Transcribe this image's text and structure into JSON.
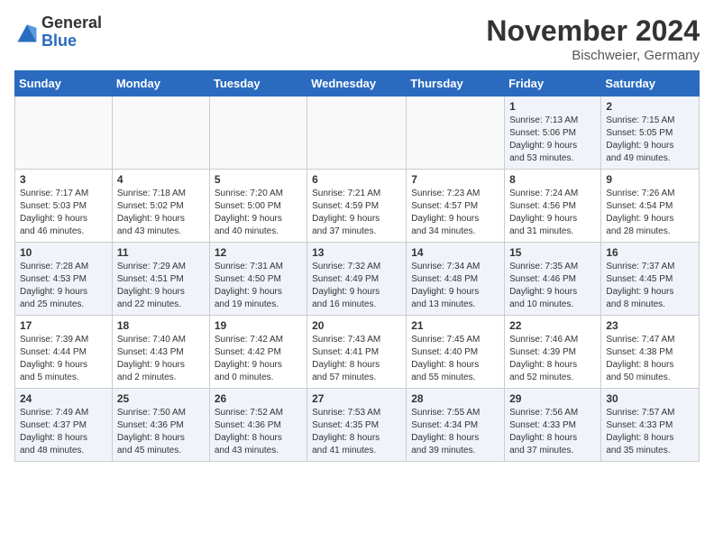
{
  "header": {
    "logo_general": "General",
    "logo_blue": "Blue",
    "month_title": "November 2024",
    "location": "Bischweier, Germany"
  },
  "weekdays": [
    "Sunday",
    "Monday",
    "Tuesday",
    "Wednesday",
    "Thursday",
    "Friday",
    "Saturday"
  ],
  "weeks": [
    [
      {
        "day": "",
        "info": ""
      },
      {
        "day": "",
        "info": ""
      },
      {
        "day": "",
        "info": ""
      },
      {
        "day": "",
        "info": ""
      },
      {
        "day": "",
        "info": ""
      },
      {
        "day": "1",
        "info": "Sunrise: 7:13 AM\nSunset: 5:06 PM\nDaylight: 9 hours\nand 53 minutes."
      },
      {
        "day": "2",
        "info": "Sunrise: 7:15 AM\nSunset: 5:05 PM\nDaylight: 9 hours\nand 49 minutes."
      }
    ],
    [
      {
        "day": "3",
        "info": "Sunrise: 7:17 AM\nSunset: 5:03 PM\nDaylight: 9 hours\nand 46 minutes."
      },
      {
        "day": "4",
        "info": "Sunrise: 7:18 AM\nSunset: 5:02 PM\nDaylight: 9 hours\nand 43 minutes."
      },
      {
        "day": "5",
        "info": "Sunrise: 7:20 AM\nSunset: 5:00 PM\nDaylight: 9 hours\nand 40 minutes."
      },
      {
        "day": "6",
        "info": "Sunrise: 7:21 AM\nSunset: 4:59 PM\nDaylight: 9 hours\nand 37 minutes."
      },
      {
        "day": "7",
        "info": "Sunrise: 7:23 AM\nSunset: 4:57 PM\nDaylight: 9 hours\nand 34 minutes."
      },
      {
        "day": "8",
        "info": "Sunrise: 7:24 AM\nSunset: 4:56 PM\nDaylight: 9 hours\nand 31 minutes."
      },
      {
        "day": "9",
        "info": "Sunrise: 7:26 AM\nSunset: 4:54 PM\nDaylight: 9 hours\nand 28 minutes."
      }
    ],
    [
      {
        "day": "10",
        "info": "Sunrise: 7:28 AM\nSunset: 4:53 PM\nDaylight: 9 hours\nand 25 minutes."
      },
      {
        "day": "11",
        "info": "Sunrise: 7:29 AM\nSunset: 4:51 PM\nDaylight: 9 hours\nand 22 minutes."
      },
      {
        "day": "12",
        "info": "Sunrise: 7:31 AM\nSunset: 4:50 PM\nDaylight: 9 hours\nand 19 minutes."
      },
      {
        "day": "13",
        "info": "Sunrise: 7:32 AM\nSunset: 4:49 PM\nDaylight: 9 hours\nand 16 minutes."
      },
      {
        "day": "14",
        "info": "Sunrise: 7:34 AM\nSunset: 4:48 PM\nDaylight: 9 hours\nand 13 minutes."
      },
      {
        "day": "15",
        "info": "Sunrise: 7:35 AM\nSunset: 4:46 PM\nDaylight: 9 hours\nand 10 minutes."
      },
      {
        "day": "16",
        "info": "Sunrise: 7:37 AM\nSunset: 4:45 PM\nDaylight: 9 hours\nand 8 minutes."
      }
    ],
    [
      {
        "day": "17",
        "info": "Sunrise: 7:39 AM\nSunset: 4:44 PM\nDaylight: 9 hours\nand 5 minutes."
      },
      {
        "day": "18",
        "info": "Sunrise: 7:40 AM\nSunset: 4:43 PM\nDaylight: 9 hours\nand 2 minutes."
      },
      {
        "day": "19",
        "info": "Sunrise: 7:42 AM\nSunset: 4:42 PM\nDaylight: 9 hours\nand 0 minutes."
      },
      {
        "day": "20",
        "info": "Sunrise: 7:43 AM\nSunset: 4:41 PM\nDaylight: 8 hours\nand 57 minutes."
      },
      {
        "day": "21",
        "info": "Sunrise: 7:45 AM\nSunset: 4:40 PM\nDaylight: 8 hours\nand 55 minutes."
      },
      {
        "day": "22",
        "info": "Sunrise: 7:46 AM\nSunset: 4:39 PM\nDaylight: 8 hours\nand 52 minutes."
      },
      {
        "day": "23",
        "info": "Sunrise: 7:47 AM\nSunset: 4:38 PM\nDaylight: 8 hours\nand 50 minutes."
      }
    ],
    [
      {
        "day": "24",
        "info": "Sunrise: 7:49 AM\nSunset: 4:37 PM\nDaylight: 8 hours\nand 48 minutes."
      },
      {
        "day": "25",
        "info": "Sunrise: 7:50 AM\nSunset: 4:36 PM\nDaylight: 8 hours\nand 45 minutes."
      },
      {
        "day": "26",
        "info": "Sunrise: 7:52 AM\nSunset: 4:36 PM\nDaylight: 8 hours\nand 43 minutes."
      },
      {
        "day": "27",
        "info": "Sunrise: 7:53 AM\nSunset: 4:35 PM\nDaylight: 8 hours\nand 41 minutes."
      },
      {
        "day": "28",
        "info": "Sunrise: 7:55 AM\nSunset: 4:34 PM\nDaylight: 8 hours\nand 39 minutes."
      },
      {
        "day": "29",
        "info": "Sunrise: 7:56 AM\nSunset: 4:33 PM\nDaylight: 8 hours\nand 37 minutes."
      },
      {
        "day": "30",
        "info": "Sunrise: 7:57 AM\nSunset: 4:33 PM\nDaylight: 8 hours\nand 35 minutes."
      }
    ]
  ]
}
